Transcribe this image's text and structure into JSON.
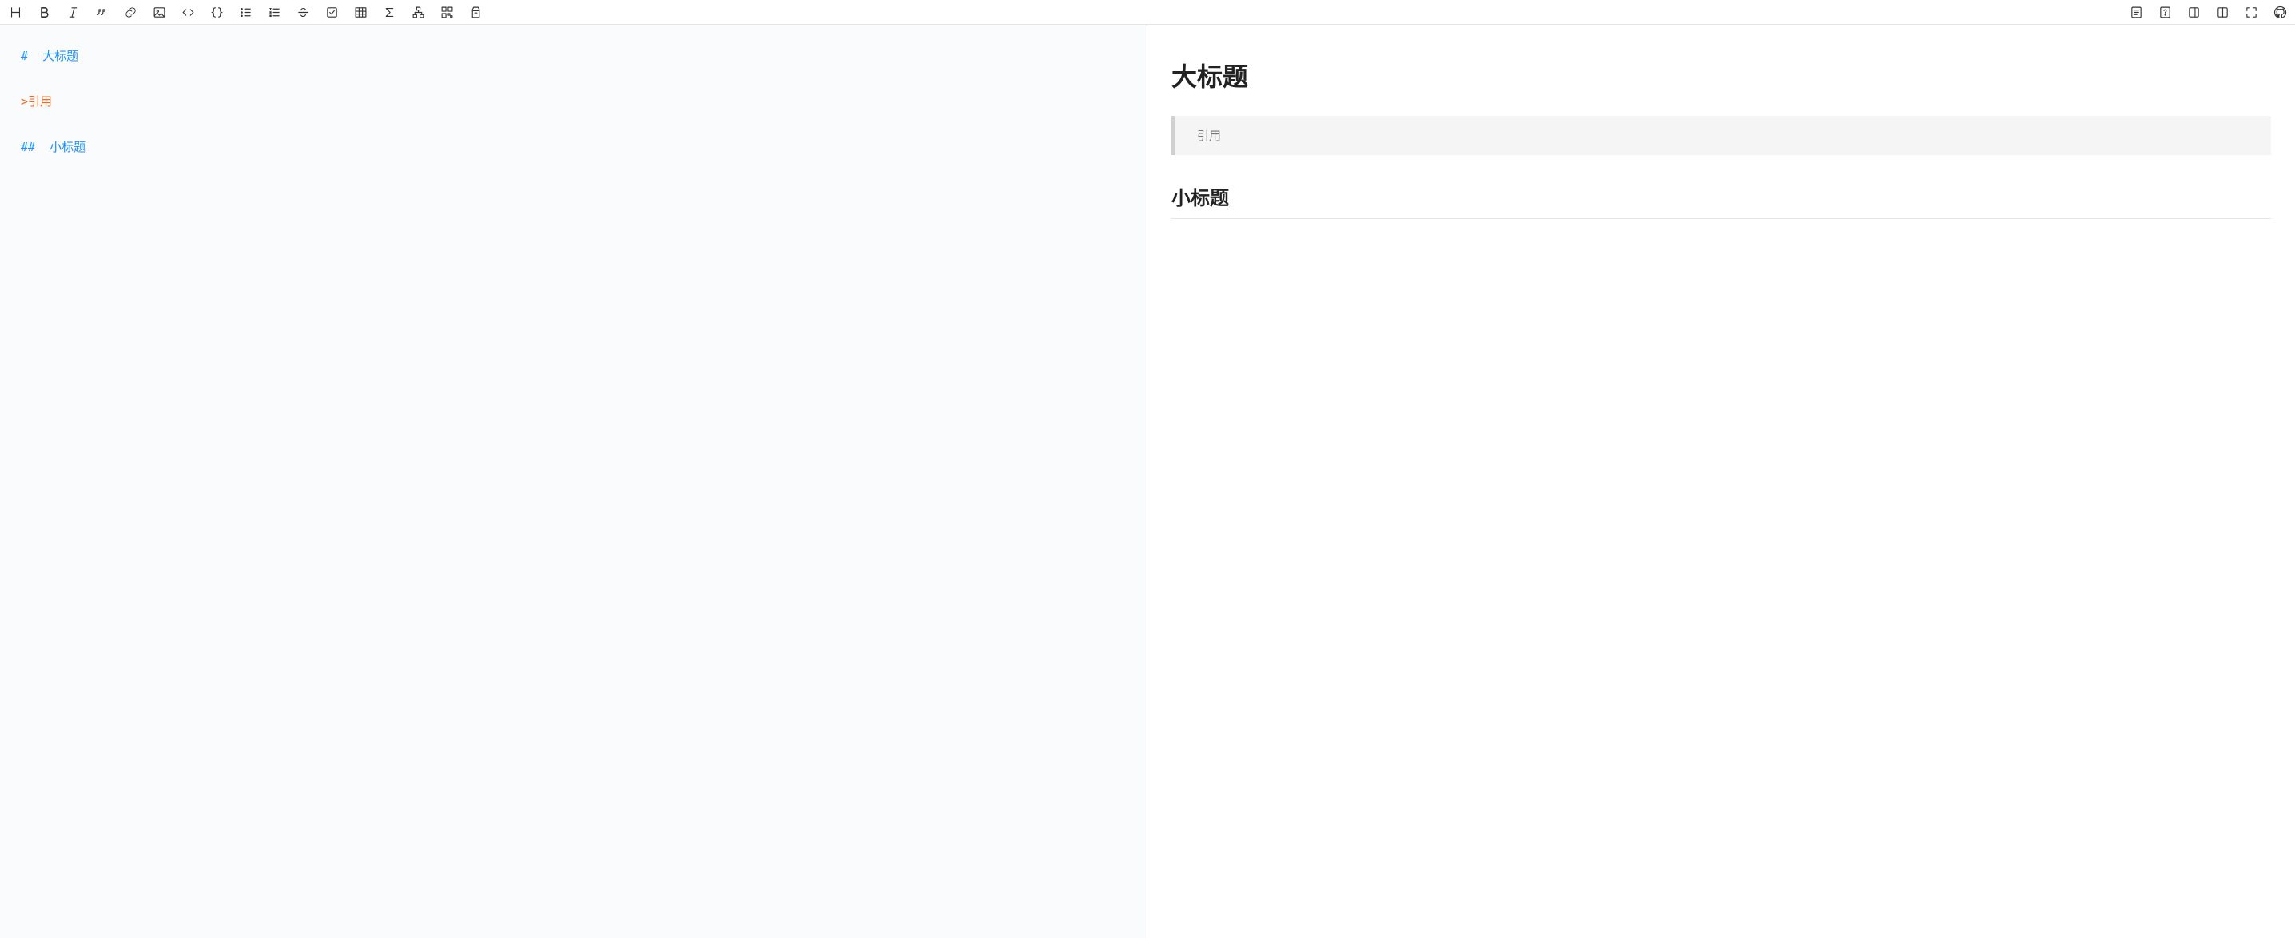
{
  "toolbar": {
    "left_icons": [
      "heading-icon",
      "bold-icon",
      "italic-icon",
      "quote-icon",
      "link-icon",
      "image-icon",
      "code-icon",
      "braces-icon",
      "unordered-list-icon",
      "ordered-list-icon",
      "strikethrough-icon",
      "task-list-icon",
      "table-icon",
      "sum-icon",
      "diagram-icon",
      "qrcode-icon",
      "export-icon"
    ],
    "right_icons": [
      "outline-icon",
      "help-icon",
      "single-pane-icon",
      "split-pane-icon",
      "fullscreen-icon",
      "github-icon"
    ]
  },
  "editor": {
    "lines": [
      {
        "type": "heading1",
        "marker": "#",
        "text": "大标题"
      },
      {
        "type": "blank",
        "marker": "",
        "text": ""
      },
      {
        "type": "quote",
        "marker": ">",
        "text": "引用"
      },
      {
        "type": "blank",
        "marker": "",
        "text": ""
      },
      {
        "type": "heading2",
        "marker": "##",
        "text": "小标题"
      }
    ]
  },
  "preview": {
    "h1": "大标题",
    "blockquote": "引用",
    "h2": "小标题"
  }
}
